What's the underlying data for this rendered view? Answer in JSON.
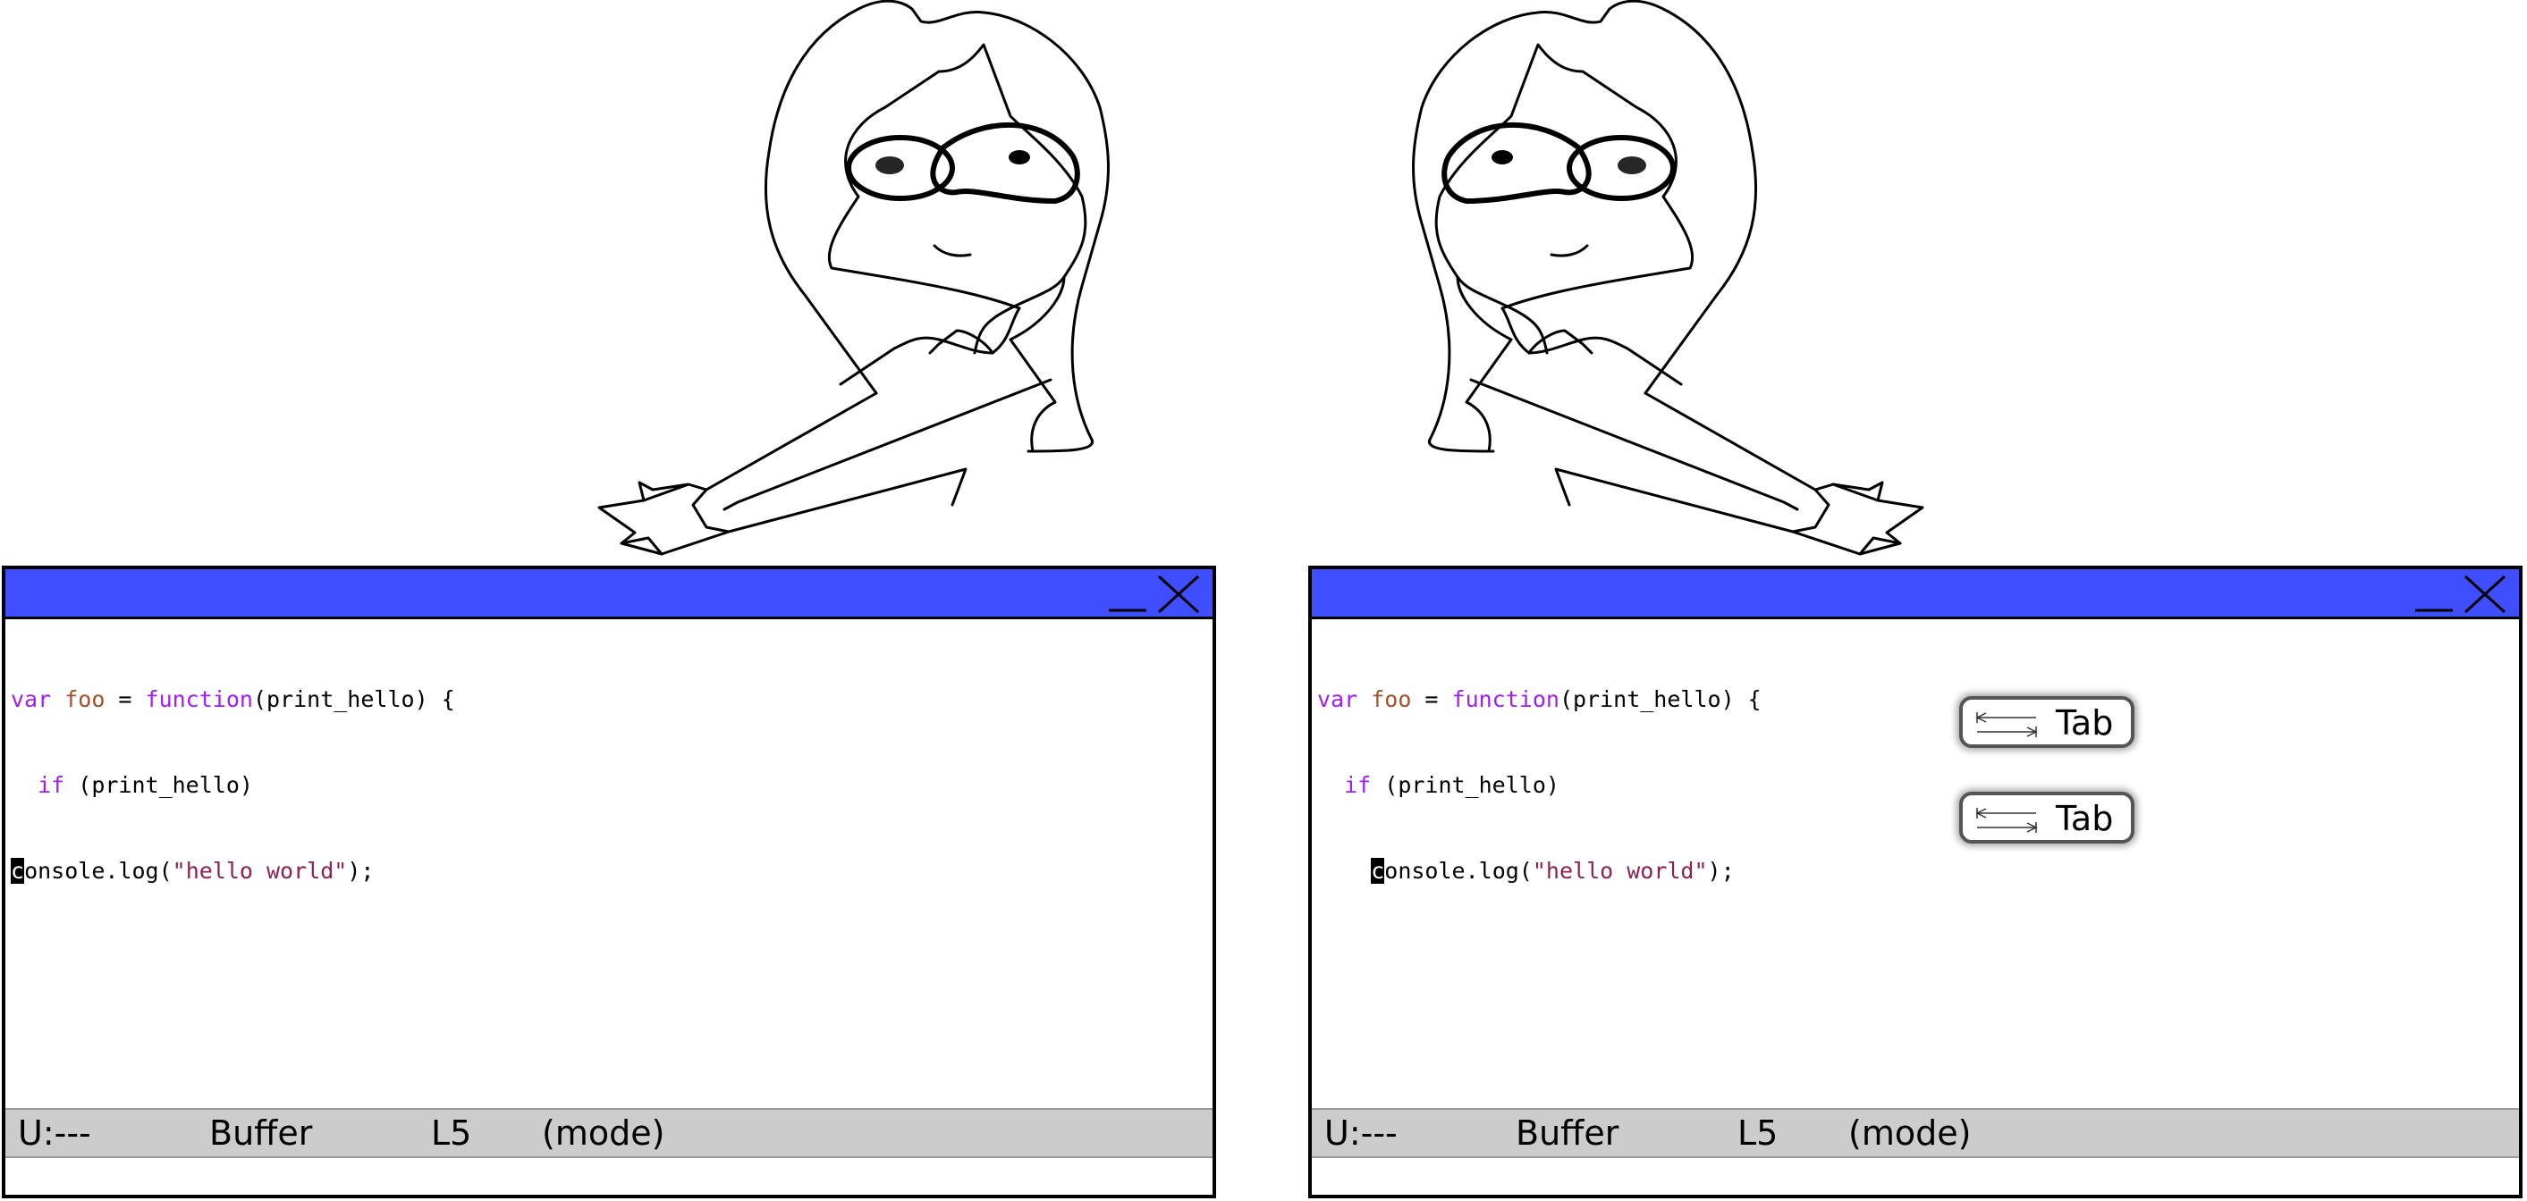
{
  "windows": [
    {
      "code": {
        "line1": {
          "kw1": "var",
          "name": "foo",
          "eq": " = ",
          "kw2": "function",
          "rest": "(print_hello) {"
        },
        "line2": {
          "indent": "  ",
          "kw": "if",
          "rest": " (print_hello)"
        },
        "line3": {
          "indent": "",
          "cursor": "c",
          "rest1": "onsole.log(",
          "str": "\"hello world\"",
          "rest2": ");"
        }
      },
      "modeline": {
        "status": "U:---",
        "buffer": "Buffer",
        "line": "L5",
        "mode": "(mode)"
      }
    },
    {
      "code": {
        "line1": {
          "kw1": "var",
          "name": "foo",
          "eq": " = ",
          "kw2": "function",
          "rest": "(print_hello) {"
        },
        "line2": {
          "indent": "  ",
          "kw": "if",
          "rest": " (print_hello)"
        },
        "line3": {
          "indent": "    ",
          "cursor": "c",
          "rest1": "onsole.log(",
          "str": "\"hello world\"",
          "rest2": ");"
        }
      },
      "modeline": {
        "status": "U:---",
        "buffer": "Buffer",
        "line": "L5",
        "mode": "(mode)"
      }
    }
  ],
  "tab_keys": [
    {
      "label": "Tab",
      "icon": "tab-arrows-icon"
    },
    {
      "label": "Tab",
      "icon": "tab-arrows-icon"
    }
  ],
  "colors": {
    "titlebar": "#3f4fff",
    "modeline": "#cccccc",
    "keyword": "#a020f0",
    "variable": "#a0522d",
    "string": "#8b2252"
  },
  "illustrations": [
    "shrugging-girl-left",
    "shrugging-girl-right"
  ]
}
